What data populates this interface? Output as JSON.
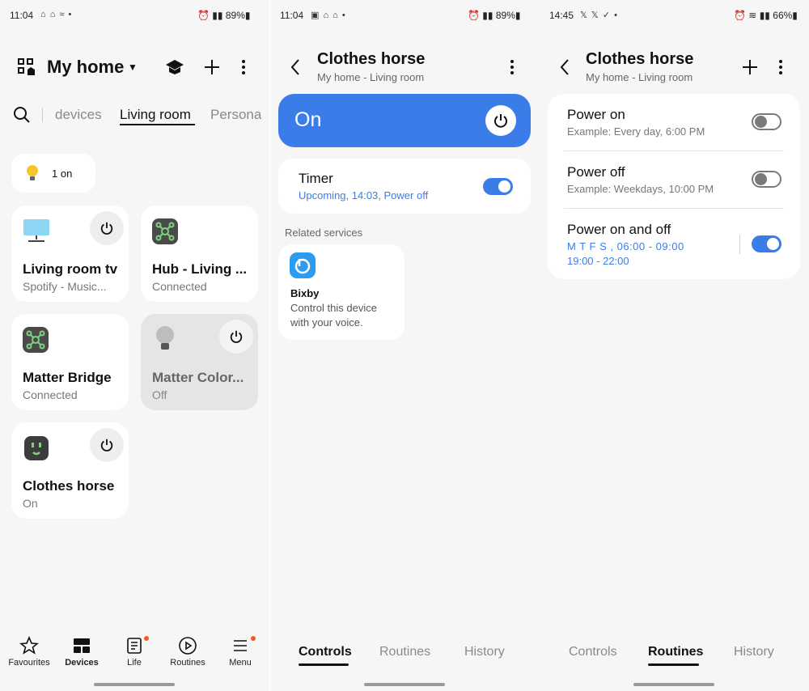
{
  "screen1": {
    "status": {
      "time": "11:04",
      "battery": "89%"
    },
    "header": {
      "title": "My home"
    },
    "filter_tabs": [
      "devices",
      "Living room",
      "Persona"
    ],
    "lights_chip": "1 on",
    "devices": [
      {
        "name": "Living room tv",
        "status": "Spotify - Music..."
      },
      {
        "name": "Hub - Living ...",
        "status": "Connected"
      },
      {
        "name": "Matter Bridge",
        "status": "Connected"
      },
      {
        "name": "Matter Color...",
        "status": "Off"
      },
      {
        "name": "Clothes horse",
        "status": "On"
      }
    ],
    "bottom_nav": [
      "Favourites",
      "Devices",
      "Life",
      "Routines",
      "Menu"
    ]
  },
  "screen2": {
    "status": {
      "time": "11:04",
      "battery": "89%"
    },
    "header": {
      "title": "Clothes horse",
      "subtitle": "My home - Living room"
    },
    "power_card": {
      "state": "On"
    },
    "timer": {
      "label": "Timer",
      "detail": "Upcoming, 14:03, Power off",
      "enabled": true
    },
    "related_label": "Related services",
    "bixby": {
      "title": "Bixby",
      "desc_line1": "Control this device",
      "desc_line2": "with your voice."
    },
    "tabs": [
      "Controls",
      "Routines",
      "History"
    ],
    "active_tab": "Controls"
  },
  "screen3": {
    "status": {
      "time": "14:45",
      "battery": "66%"
    },
    "header": {
      "title": "Clothes horse",
      "subtitle": "My home - Living room"
    },
    "routines": [
      {
        "title": "Power on",
        "sub": "Example: Every day, 6:00 PM",
        "enabled": false
      },
      {
        "title": "Power off",
        "sub": "Example: Weekdays, 10:00 PM",
        "enabled": false
      },
      {
        "title": "Power on and off",
        "sub1": "M T F S , 06:00 - 09:00",
        "sub2": "19:00 - 22:00",
        "enabled": true
      }
    ],
    "tabs": [
      "Controls",
      "Routines",
      "History"
    ],
    "active_tab": "Routines"
  },
  "colors": {
    "accent": "#3b7de8",
    "badge": "#f05a28",
    "hub_icon_bg": "#4a4a4a",
    "hub_icon_fg": "#7ed37e"
  }
}
